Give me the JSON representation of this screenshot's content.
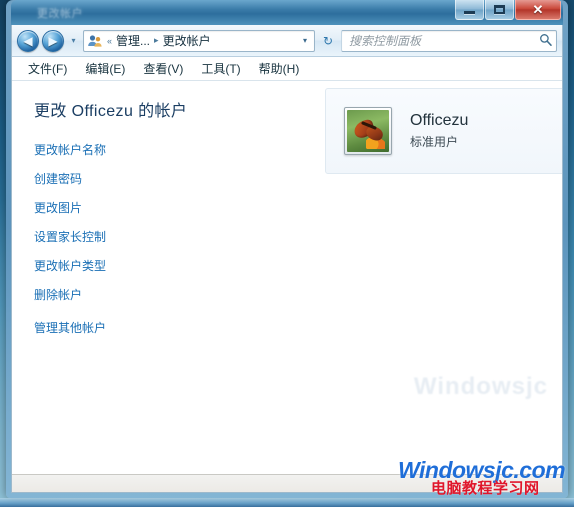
{
  "window": {
    "title": "更改帐户",
    "controls": {
      "minimize": "最小化",
      "maximize": "最大化",
      "close": "关闭",
      "close_glyph": "✕"
    }
  },
  "navbar": {
    "back_label": "后退",
    "back_glyph": "◀",
    "forward_label": "前进",
    "forward_glyph": "▶",
    "history_glyph": "▾",
    "breadcrumb": {
      "icon": "user-accounts-icon",
      "overflow": "«",
      "items": [
        {
          "label": "管理...",
          "separator": "▸"
        },
        {
          "label": "更改帐户",
          "separator": ""
        }
      ]
    },
    "address_dropdown_glyph": "▾",
    "refresh_glyph": "↻",
    "refresh_label": "刷新"
  },
  "search": {
    "placeholder": "搜索控制面板",
    "icon": "search-icon",
    "icon_glyph": "🔍"
  },
  "menubar": {
    "items": [
      {
        "label": "文件(F)"
      },
      {
        "label": "编辑(E)"
      },
      {
        "label": "查看(V)"
      },
      {
        "label": "工具(T)"
      },
      {
        "label": "帮助(H)"
      }
    ]
  },
  "content": {
    "page_title": "更改 Officezu 的帐户",
    "task_links": [
      {
        "label": "更改帐户名称"
      },
      {
        "label": "创建密码"
      },
      {
        "label": "更改图片"
      },
      {
        "label": "设置家长控制"
      },
      {
        "label": "更改帐户类型"
      },
      {
        "label": "删除帐户"
      },
      {
        "label": "管理其他帐户"
      }
    ],
    "account": {
      "name": "Officezu",
      "type": "标准用户",
      "avatar": "butterfly-avatar-icon"
    },
    "ghost_watermark": "Windowsjc"
  },
  "statusbar": {
    "text": ""
  },
  "watermarks": {
    "main": "Windowsjc.com",
    "sub": "电脑教程学习网"
  },
  "colors": {
    "link": "#1a6fb5",
    "title": "#1b3e63",
    "watermark_blue": "#1f6ed8",
    "watermark_red": "#e0162b",
    "close_button": "#b3352a"
  }
}
